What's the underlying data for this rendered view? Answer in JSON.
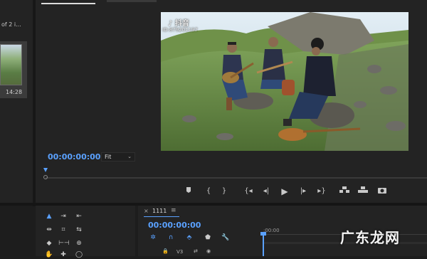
{
  "project": {
    "count_text": "of 2 i...",
    "clip_duration": "14:28"
  },
  "monitor": {
    "timecode": "00:00:00:00",
    "fit": "Fit",
    "watermark_brand": "抖音",
    "watermark_id": "ID:879201197",
    "transport_icons": [
      "marker-icon",
      "mark-in-icon",
      "mark-out-icon",
      "go-to-in-icon",
      "step-back-icon",
      "play-icon",
      "step-forward-icon",
      "go-to-out-icon",
      "insert-icon",
      "overwrite-icon",
      "export-frame-icon"
    ]
  },
  "timeline": {
    "sequence_name": "1111",
    "timecode": "00:00:00:00",
    "ruler_start": ":00:00",
    "track_label": "V3"
  },
  "site_watermark": "广东龙网",
  "colors": {
    "accent": "#5aa1ff",
    "panel": "#232323",
    "background": "#1d1d1d"
  }
}
